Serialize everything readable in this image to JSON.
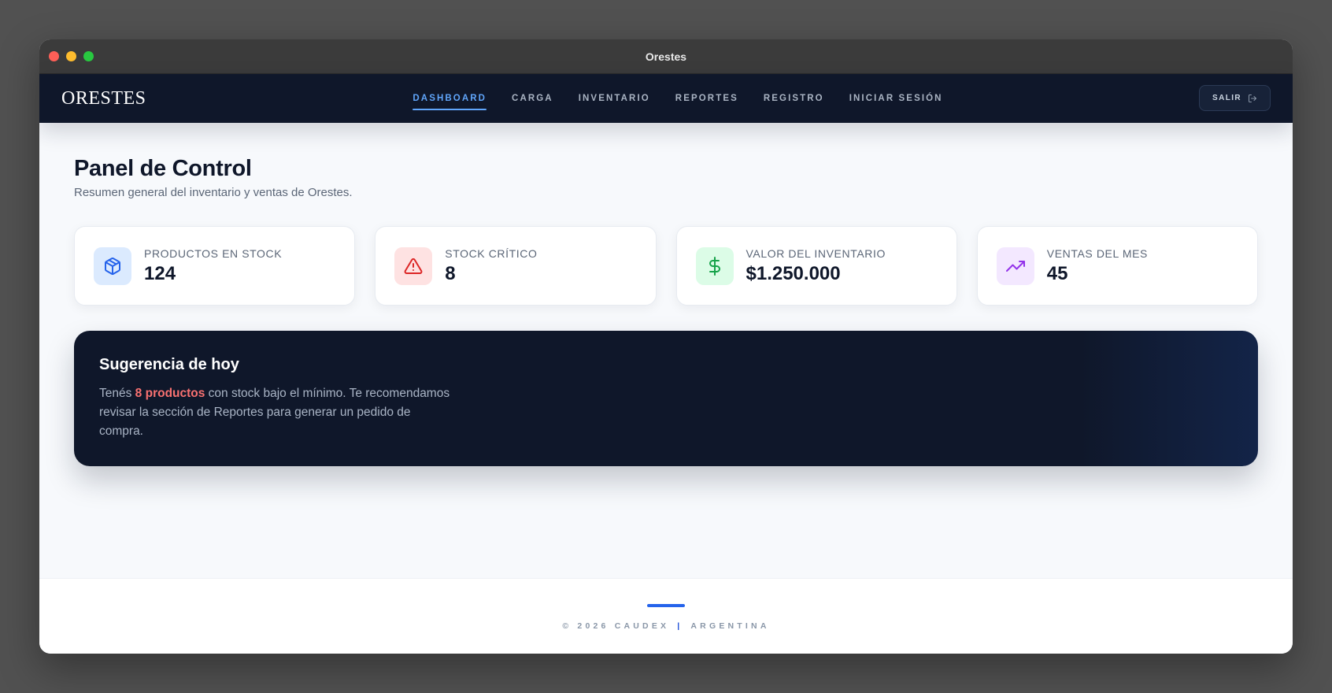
{
  "window": {
    "title": "Orestes"
  },
  "navbar": {
    "brand": "ORESTES",
    "links": [
      {
        "label": "DASHBOARD",
        "active": true
      },
      {
        "label": "CARGA"
      },
      {
        "label": "INVENTARIO"
      },
      {
        "label": "REPORTES"
      },
      {
        "label": "REGISTRO"
      },
      {
        "label": "INICIAR SESIÓN"
      }
    ],
    "logout_label": "SALIR"
  },
  "header": {
    "title": "Panel de Control",
    "subtitle": "Resumen general del inventario y ventas de Orestes."
  },
  "stats": [
    {
      "label": "PRODUCTOS EN STOCK",
      "value": "124",
      "icon": "box-icon",
      "color": "#2563eb"
    },
    {
      "label": "STOCK CRÍTICO",
      "value": "8",
      "icon": "warning-icon",
      "color": "#dc2626"
    },
    {
      "label": "VALOR DEL INVENTARIO",
      "value": "$1.250.000",
      "icon": "dollar-icon",
      "color": "#16a34a"
    },
    {
      "label": "VENTAS DEL MES",
      "value": "45",
      "icon": "trending-up-icon",
      "color": "#9333ea"
    }
  ],
  "suggestion": {
    "title": "Sugerencia de hoy",
    "text_before": "Tenés ",
    "highlight": "8 productos",
    "text_after": " con stock bajo el mínimo. Te recomendamos revisar la sección de Reportes para generar un pedido de compra."
  },
  "footer": {
    "left": "© 2026 CAUDEX",
    "separator": "|",
    "right": "ARGENTINA"
  },
  "colors": {
    "navbar_bg": "#0f172a",
    "accent": "#60a5fa",
    "highlight": "#f87171",
    "footer_accent": "#2563eb"
  }
}
